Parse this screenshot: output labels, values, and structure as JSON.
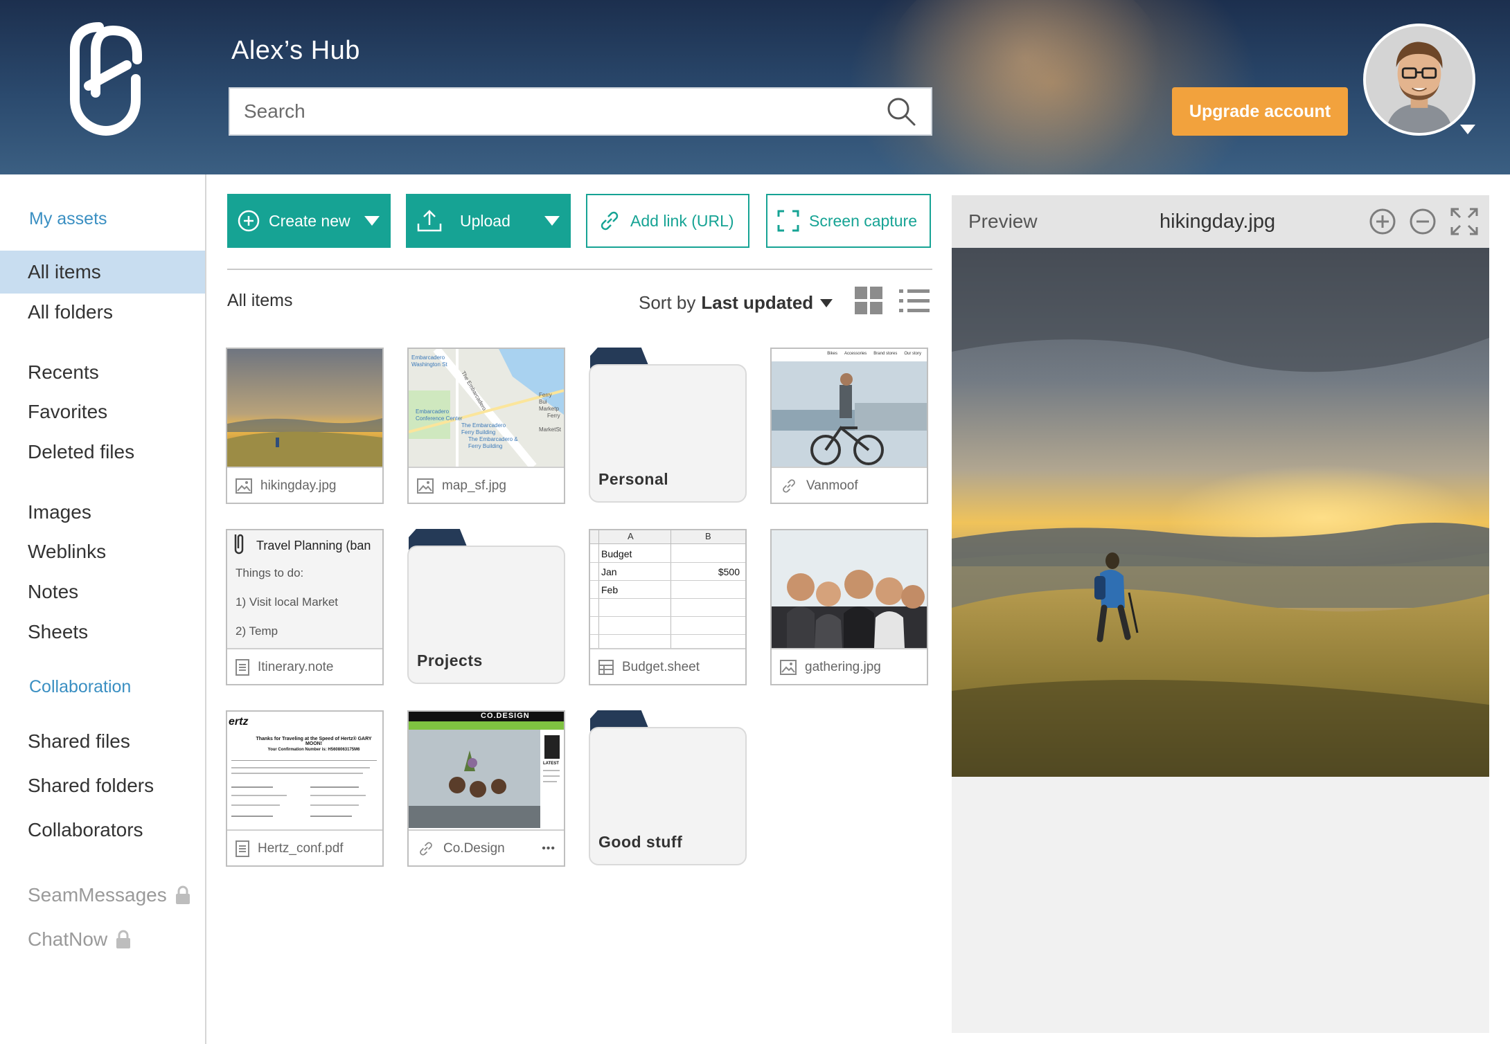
{
  "header": {
    "title": "Alex’s Hub",
    "search_placeholder": "Search",
    "upgrade_label": "Upgrade account"
  },
  "colors": {
    "accent": "#16a394",
    "upgrade": "#f2a23d",
    "sidebar_section": "#3a8fc2",
    "active_item_bg": "#c8ddf0",
    "folder_tab": "#253a57"
  },
  "sidebar": {
    "my_assets": "My assets",
    "items": [
      {
        "label": "All items",
        "active": true
      },
      {
        "label": "All folders"
      },
      {
        "label": "Recents"
      },
      {
        "label": "Favorites"
      },
      {
        "label": "Deleted files"
      },
      {
        "label": "Images"
      },
      {
        "label": "Weblinks"
      },
      {
        "label": "Notes"
      },
      {
        "label": "Sheets"
      }
    ],
    "collaboration": "Collaboration",
    "collab_items": [
      {
        "label": "Shared files"
      },
      {
        "label": "Shared folders"
      },
      {
        "label": "Collaborators"
      }
    ],
    "locked_items": [
      {
        "label": "SeamMessages",
        "icon": "lock-icon"
      },
      {
        "label": "ChatNow",
        "icon": "lock-icon"
      }
    ]
  },
  "toolbar": {
    "create_new": "Create new",
    "upload": "Upload",
    "add_link": "Add link (URL)",
    "screen_capture": "Screen capture"
  },
  "content": {
    "section_title": "All items",
    "sort_prefix": "Sort by",
    "sort_value": "Last updated",
    "items": [
      {
        "name": "hikingday.jpg",
        "kind": "image",
        "icon": "image-icon"
      },
      {
        "name": "map_sf.jpg",
        "kind": "image",
        "icon": "image-icon",
        "map_labels": [
          "Embarcadero Washington St",
          "The Embarcadero",
          "Ferry Bui Marketp",
          "Embarcadero Conference Center",
          "The Embarcadero Ferry Building",
          "The Embarcadero & Ferry Building",
          "Ferry",
          "MarketSt"
        ]
      },
      {
        "name": "Personal",
        "kind": "folder"
      },
      {
        "name": "Vanmoof",
        "kind": "weblink",
        "icon": "link-icon",
        "nav": [
          "Bikes",
          "Accessories",
          "Brand stores",
          "Our story"
        ]
      },
      {
        "name": "Itinerary.note",
        "kind": "note",
        "icon": "note-icon",
        "note_title": "Travel Planning (ban",
        "note_lines": [
          "Things to do:",
          "1) Visit local Market",
          "2) Temp"
        ]
      },
      {
        "name": "Projects",
        "kind": "folder"
      },
      {
        "name": "Budget.sheet",
        "kind": "sheet",
        "icon": "sheet-icon",
        "columns": [
          "A",
          "B"
        ],
        "rows": [
          [
            "Budget",
            ""
          ],
          [
            "Jan",
            "$500"
          ],
          [
            "Feb",
            ""
          ],
          [
            "",
            ""
          ],
          [
            "",
            ""
          ]
        ]
      },
      {
        "name": "gathering.jpg",
        "kind": "image",
        "icon": "image-icon"
      },
      {
        "name": "Hertz_conf.pdf",
        "kind": "document",
        "icon": "document-icon",
        "doc_brand": "ertz",
        "doc_heading": "Thanks for Traveling at the Speed of Hertz® GARY MOON!",
        "doc_sub": "Your Confirmation Number is: H5608063175M6"
      },
      {
        "name": "Co.Design",
        "kind": "weblink",
        "icon": "link-icon",
        "more": "•••",
        "site_title": "CO.DESIGN",
        "side_label": "LATEST"
      },
      {
        "name": "Good stuff",
        "kind": "folder"
      }
    ]
  },
  "preview": {
    "label": "Preview",
    "filename": "hikingday.jpg",
    "icons": [
      "zoom-in-icon",
      "zoom-out-icon",
      "fullscreen-icon"
    ]
  }
}
